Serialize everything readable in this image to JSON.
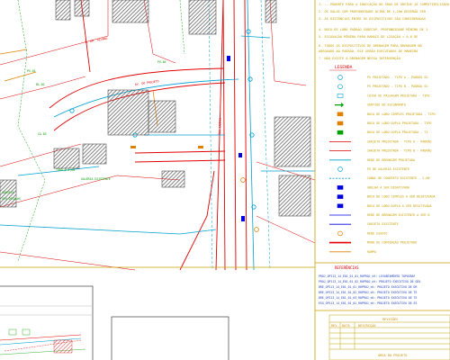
{
  "drawing": {
    "colors": {
      "paper": "#ffffff",
      "frame": "#c8a000",
      "existing_lines": "#e00000",
      "projected_lines": "#00a0d0",
      "buildings": "#606060",
      "green_labels": "#00a000",
      "blue_elements": "#0000e0",
      "notes_text": "#c8a000"
    },
    "notes": [
      "1- ...PONENTE PARA A INDICAÇÃO DO GRAU DE GREIDE JÁ COMPATIBILIZADO",
      "2- OS VALOS COM PROFUNDIDADE ACIMA DE 1,20m DEVERÃO SER",
      "3- AS DISTÂNCIAS ENTRE OS DISPOSITIVOS SÃO CONSIDERADAS",
      "4- BOCA DE LOBO PADRÃO SUDECAP, PROFUNDIDADE MÍNIMA DE 1",
      "5- ESCAVAÇÃO MÍNIMA PARA RAMAIS DE LIGAÇÃO = 0,6 DE",
      "6- TODOS OS DISPOSITIVOS DE DRENAGEM PARA DRENAGEM NO",
      "   ADEQUADO AO PADRÃO, ESE SERÃO EXECUTADOS DE MANEIRA",
      "7- NÃO EXISTE A DRENAGEM NESSA INTERVENÇÃO"
    ],
    "legend": {
      "title": "LEGENDA",
      "items": [
        {
          "symbol": "circle-cyan",
          "label": "PV PROJETADO - TIPO A - PADRÃO SU"
        },
        {
          "symbol": "circle-cyan",
          "label": "PV PROJETADO - TIPO B - PADRÃO SU"
        },
        {
          "symbol": "square-cyan",
          "label": "CAIXA DE PASSAGEM PROJETADA - TIPO"
        },
        {
          "symbol": "arrow-green",
          "label": "SENTIDO DO ESCOAMENTO"
        },
        {
          "symbol": "rect-orange",
          "label": "BOCA DE LOBO SIMPLES PROJETADA - TIPO"
        },
        {
          "symbol": "rect-orange",
          "label": "BOCA DE LOBO DUPLA PROJETADA - TIPO"
        },
        {
          "symbol": "rect-green",
          "label": "BOCA DE LOBO DUPLA PROJETADA - TI"
        },
        {
          "symbol": "line-red",
          "label": "SARJETA PROJETADA - TIPO A - PADRÃO"
        },
        {
          "symbol": "line-red",
          "label": "SARJETA PROJETADA - TIPO B - PADRÃO"
        },
        {
          "symbol": "line-cyan",
          "label": "REDE DE DRENAGEM PROJETADA"
        },
        {
          "symbol": "circle-cyan",
          "label": "PV DE GALERIA EXISTENTE"
        },
        {
          "symbol": "line-cyan-dash",
          "label": "CANAL DE CONCRETO EXISTENTE - 2,00"
        },
        {
          "symbol": "grate-blue",
          "label": "GRELHA A SER DESATIVADA"
        },
        {
          "symbol": "rect-blue",
          "label": "BOCA DE LOBO SIMPLES A SER DESATIVADA"
        },
        {
          "symbol": "rect-blue",
          "label": "BOCA DE LOBO DUPLA A SER DESATIVADA"
        },
        {
          "symbol": "line-blue",
          "label": "REDE DE DRENAGEM EXISTENTE A SER D"
        },
        {
          "symbol": "line-blue",
          "label": "SARJETA EXISTENTE"
        },
        {
          "symbol": "circle-orange",
          "label": "REDE ESGOTO"
        },
        {
          "symbol": "line-red-thick",
          "label": "MURO DE CONTENÇÃO PROJETADO"
        },
        {
          "symbol": "line-orange",
          "label": "RAMPA"
        }
      ]
    },
    "references": {
      "title": "REFERÊNCIAS",
      "lines": [
        "PROJ_OP113_14_E01_01_01_R0PROJ_dt: LEVANTAMENTO TOPOGRAF",
        "PROJ_OP113_14_E01_01_02_R0PROJ_dt: PROJETO EXECUTIVO DE GEO",
        "DRE_OP113_14_E01_01_01_R0PROJ_dt: PROJETO EXECUTIVO DE DR",
        "DRE_OP113_14_E01_01_02_R0PROJ_dt: PROJETO EXECUTIVO DE TE",
        "DRE_OP113_14_E01_01_03_R0PROJ_dt: PROJETO EXECUTIVO DE TE",
        "ESG_OP113_14_E01_01_01_R0PROJ_dt: PROJETO EXECUTIVO DE ES"
      ]
    },
    "title_block": {
      "header": "REVISÕES",
      "col_rev": "REV.",
      "col_data": "DATA",
      "col_desc": "DESCRIÇÃO",
      "footer": "ÁREA DO PROJETO"
    },
    "map_labels": [
      {
        "text": "R. DR. ALVARO",
        "color": "#e00000"
      },
      {
        "text": "PV-01",
        "color": "#00a000"
      },
      {
        "text": "BL-02",
        "color": "#00a000"
      },
      {
        "text": "CA-03",
        "color": "#00a000"
      },
      {
        "text": "PV-04",
        "color": "#00a000"
      },
      {
        "text": "RUA CAMPOS",
        "color": "#e00000"
      },
      {
        "text": "TUBO Ø 0,60",
        "color": "#00a000"
      },
      {
        "text": "AV. DO PROJETO",
        "color": "#e00000"
      },
      {
        "text": "SARJETA",
        "color": "#00a000"
      },
      {
        "text": "VER DETALHE",
        "color": "#00a000"
      },
      {
        "text": "GALERIA EXISTENTE",
        "color": "#00a000"
      }
    ]
  }
}
